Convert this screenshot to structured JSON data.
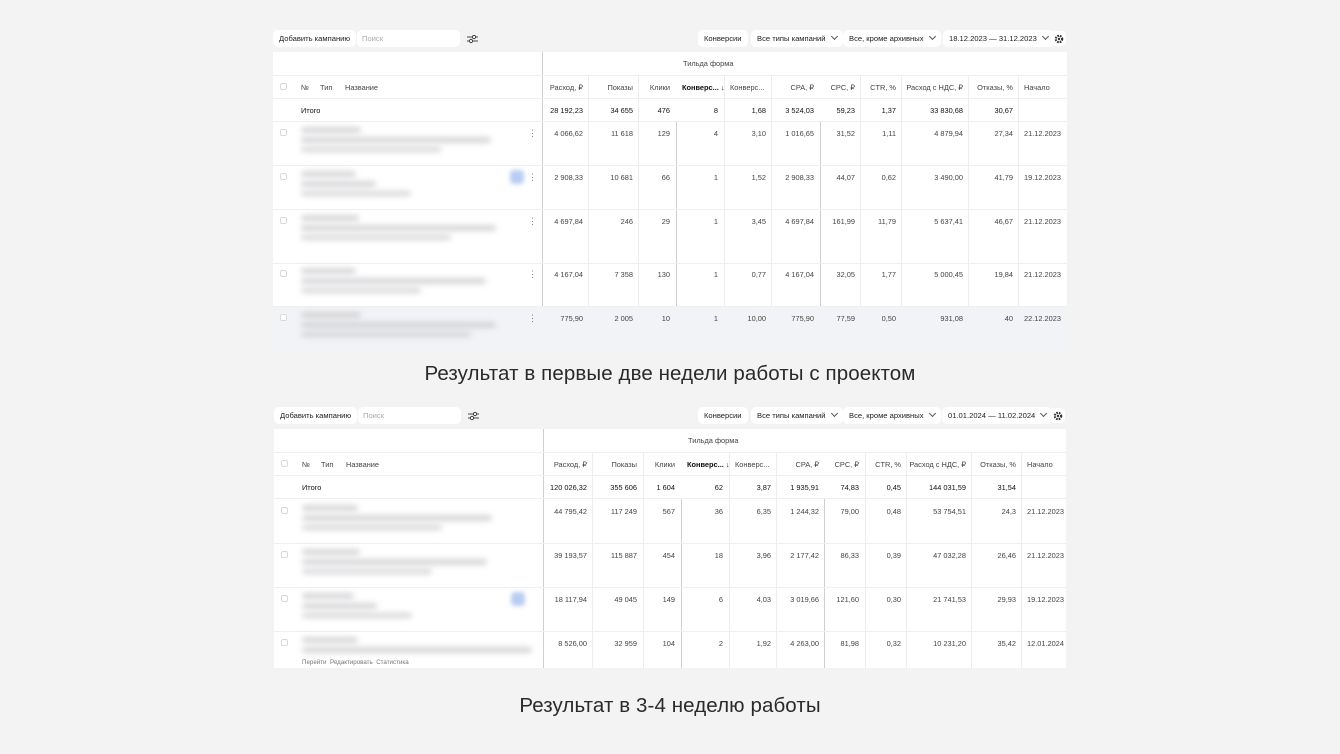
{
  "panels": [
    {
      "toolbar": {
        "add_campaign": "Добавить кампанию",
        "search_placeholder": "Поиск",
        "conversions": "Конверсии",
        "campaign_types": "Все типы кампаний",
        "archive_filter": "Все, кроме архивных",
        "date_range": "18.12.2023 — 31.12.2023"
      },
      "goal_header": "Тильда форма",
      "columns": {
        "no": "№",
        "type": "Тип",
        "name": "Название",
        "spend": "Расход, ₽",
        "impressions": "Показы",
        "clicks": "Клики",
        "conv": "Конверс...",
        "conv_rate": "Конверс...",
        "cpa": "CPA, ₽",
        "cpc": "CPC, ₽",
        "ctr": "CTR, %",
        "spend_vat": "Расход с НДС, ₽",
        "bounce": "Отказы, %",
        "start": "Начало"
      },
      "total": {
        "label": "Итого",
        "values": [
          "28 192,23",
          "34 655",
          "476",
          "8",
          "1,68",
          "3 524,03",
          "59,23",
          "1,37",
          "33 830,68",
          "30,67",
          ""
        ]
      },
      "rows": [
        [
          "4 066,62",
          "11 618",
          "129",
          "4",
          "3,10",
          "1 016,65",
          "31,52",
          "1,11",
          "4 879,94",
          "27,34",
          "21.12.2023"
        ],
        [
          "2 908,33",
          "10 681",
          "66",
          "1",
          "1,52",
          "2 908,33",
          "44,07",
          "0,62",
          "3 490,00",
          "41,79",
          "19.12.2023"
        ],
        [
          "4 697,84",
          "246",
          "29",
          "1",
          "3,45",
          "4 697,84",
          "161,99",
          "11,79",
          "5 637,41",
          "46,67",
          "21.12.2023"
        ],
        [
          "4 167,04",
          "7 358",
          "130",
          "1",
          "0,77",
          "4 167,04",
          "32,05",
          "1,77",
          "5 000,45",
          "19,84",
          "21.12.2023"
        ],
        [
          "775,90",
          "2 005",
          "10",
          "1",
          "10,00",
          "775,90",
          "77,59",
          "0,50",
          "931,08",
          "40",
          "22.12.2023"
        ]
      ]
    },
    {
      "toolbar": {
        "add_campaign": "Добавить кампанию",
        "search_placeholder": "Поиск",
        "conversions": "Конверсии",
        "campaign_types": "Все типы кампаний",
        "archive_filter": "Все, кроме архивных",
        "date_range": "01.01.2024 — 11.02.2024"
      },
      "goal_header": "Тильда форма",
      "columns": {
        "no": "№",
        "type": "Тип",
        "name": "Название",
        "spend": "Расход, ₽",
        "impressions": "Показы",
        "clicks": "Клики",
        "conv": "Конверс...",
        "conv_rate": "Конверс...",
        "cpa": "CPA, ₽",
        "cpc": "CPC, ₽",
        "ctr": "CTR, %",
        "spend_vat": "Расход с НДС, ₽",
        "bounce": "Отказы, %",
        "start": "Начало"
      },
      "total": {
        "label": "Итого",
        "values": [
          "120 026,32",
          "355 606",
          "1 604",
          "62",
          "3,87",
          "1 935,91",
          "74,83",
          "0,45",
          "144 031,59",
          "31,54",
          ""
        ]
      },
      "rows": [
        [
          "44 795,42",
          "117 249",
          "567",
          "36",
          "6,35",
          "1 244,32",
          "79,00",
          "0,48",
          "53 754,51",
          "24,3",
          "21.12.2023"
        ],
        [
          "39 193,57",
          "115 887",
          "454",
          "18",
          "3,96",
          "2 177,42",
          "86,33",
          "0,39",
          "47 032,28",
          "26,46",
          "21.12.2023"
        ],
        [
          "18 117,94",
          "49 045",
          "149",
          "6",
          "4,03",
          "3 019,66",
          "121,60",
          "0,30",
          "21 741,53",
          "29,93",
          "19.12.2023"
        ],
        [
          "8 526,00",
          "32 959",
          "104",
          "2",
          "1,92",
          "4 263,00",
          "81,98",
          "0,32",
          "10 231,20",
          "35,42",
          "12.01.2024"
        ]
      ],
      "row_links": [
        "Перейти",
        "Редактировать",
        "Статистика"
      ]
    }
  ],
  "captions": [
    "Результат в первые две недели работы с проектом",
    "Результат в 3-4 неделю работы"
  ]
}
